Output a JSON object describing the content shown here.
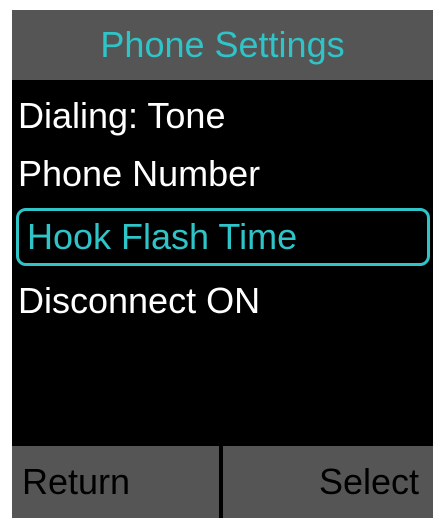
{
  "colors": {
    "background": "#000000",
    "bar": "#555555",
    "accent": "#2ec4c8",
    "text": "#ffffff",
    "softkey_text": "#000000"
  },
  "header": {
    "title": "Phone Settings"
  },
  "menu": {
    "items": [
      {
        "label": "Dialing: Tone",
        "selected": false
      },
      {
        "label": "Phone Number",
        "selected": false
      },
      {
        "label": "Hook Flash Time",
        "selected": true
      },
      {
        "label": "Disconnect ON",
        "selected": false
      }
    ]
  },
  "softkeys": {
    "left_label": "Return",
    "right_label": "Select"
  }
}
